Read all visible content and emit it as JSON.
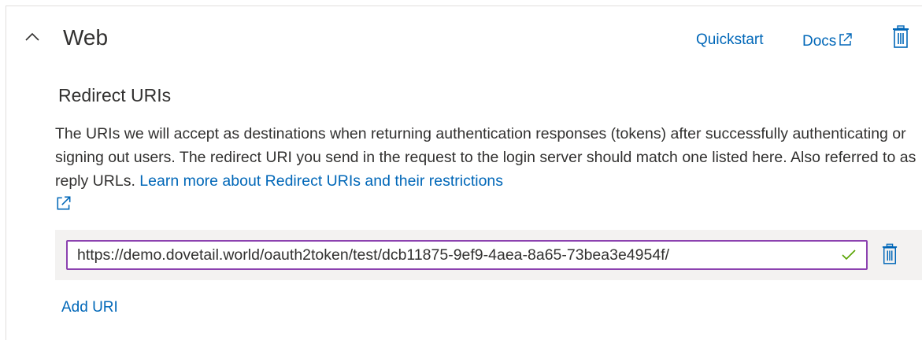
{
  "section": {
    "title": "Web",
    "collapse_icon": "chevron-up-icon",
    "quickstart_label": "Quickstart",
    "docs_label": "Docs",
    "delete_icon": "trash-icon"
  },
  "redirect_uris": {
    "title": "Redirect URIs",
    "description": "The URIs we will accept as destinations when returning authentication responses (tokens) after successfully authenticating or signing out users. The redirect URI you send in the request to the login server should match one listed here. Also referred to as reply URLs.",
    "learn_more_label": "Learn more about Redirect URIs and their restrictions",
    "uris": [
      {
        "value": "https://demo.dovetail.world/oauth2token/test/dcb11875-9ef9-4aea-8a65-73bea3e4954f/",
        "valid": true
      }
    ],
    "add_uri_label": "Add URI"
  },
  "colors": {
    "link": "#0067b8",
    "input_border": "#8c42b0",
    "check": "#57a300",
    "row_bg": "#f3f2f1"
  }
}
